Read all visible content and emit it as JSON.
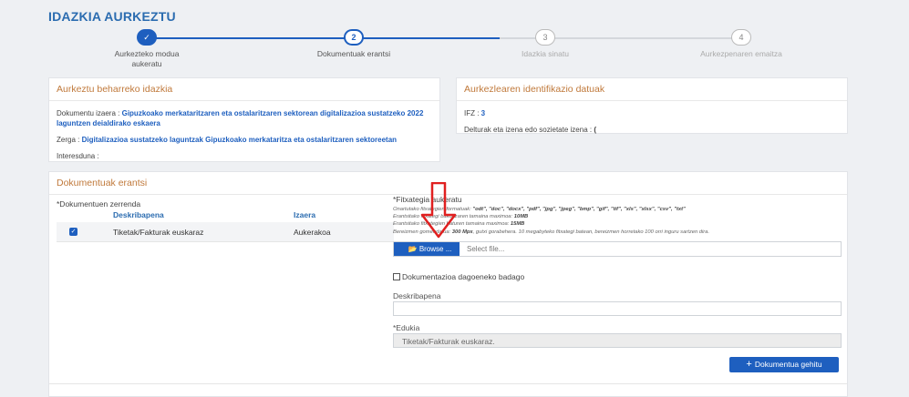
{
  "page": {
    "title": "IDAZKIA AURKEZTU"
  },
  "stepper": {
    "steps": [
      {
        "num": "✓",
        "label": "Aurkezteko modua aukeratu",
        "state": "done"
      },
      {
        "num": "2",
        "label": "Dokumentuak erantsi",
        "state": "current"
      },
      {
        "num": "3",
        "label": "Idazkia sinatu",
        "state": "pending"
      },
      {
        "num": "4",
        "label": "Aurkezpenaren emaitza",
        "state": "pending"
      }
    ]
  },
  "left_panel": {
    "title": "Aurkeztu beharreko idazkia",
    "doc_state_label": "Dokumentu izaera : ",
    "doc_state_value": "Gipuzkoako merkataritzaren eta ostalaritzaren sektorean digitalizazioa sustatzeko 2022 laguntzen deialdirako eskaera",
    "procedure_label": "Zerga : ",
    "procedure_value": "Digitalizazioa sustatzeko laguntzak Gipuzkoako merkataritza eta ostalaritzaren sektoreetan",
    "interested_label": "Interesduna : ",
    "interested_value": ""
  },
  "right_panel": {
    "title": "Aurkezlearen identifikazio datuak",
    "ifz_label": "IFZ : ",
    "ifz_value": "3",
    "name_label": "Delturak eta izena edo sozietate izena : ",
    "name_value": "("
  },
  "docs_panel": {
    "title": "Dokumentuak erantsi",
    "list_title": "*Dokumentuen zerrenda",
    "col_description": "Deskribapena",
    "col_status": "Izaera",
    "rows": [
      {
        "description": "Tiketak/Fakturak euskaraz",
        "status": "Aukerakoa",
        "checked": true
      }
    ],
    "upload_title": "*Fitxategia aukeratu",
    "note_formats_label": "Onartutako fitxategien formatuak: ",
    "note_formats_value": "\"odt\", \"doc\", \"docx\", \"pdf\", \"jpg\", \"jpeg\", \"bmp\", \"gif\", \"tif\", \"xls\", \"xlsx\", \"csv\", \"txt\"",
    "note_max_label": "Erantsitako fitxategi bakoitzaren tamaina maximoa: ",
    "note_max_value": "10MB",
    "note_total_label": "Erantsitako fitxategien baturen tamaina maximoa: ",
    "note_total_value": "15MB",
    "note_recommend_label": "Bereizmen gomendatua: ",
    "note_recommend_value": "300 Mpx",
    "note_recommend_rest": ", gutxi gorabehera. 10 megabyteko fitxategi batean, bereizmen horretako 100 orri inguru sartzen dira.",
    "browse_label": "Browse ...",
    "file_placeholder": "Select file...",
    "already_have_label": "Dokumentazioa dagoeneko badago",
    "description_label": "Deskribapena",
    "description_value": "",
    "content_label": "*Edukia",
    "content_value": "Tiketak/Fakturak euskaraz.",
    "add_button_label": "Dokumentua gehitu"
  },
  "colors": {
    "primary": "#1e5fbf",
    "accent": "#c0793b",
    "arrow": "#e02020"
  },
  "icons": {
    "folder": "folder-icon",
    "plus": "plus-icon",
    "check": "check-icon"
  }
}
